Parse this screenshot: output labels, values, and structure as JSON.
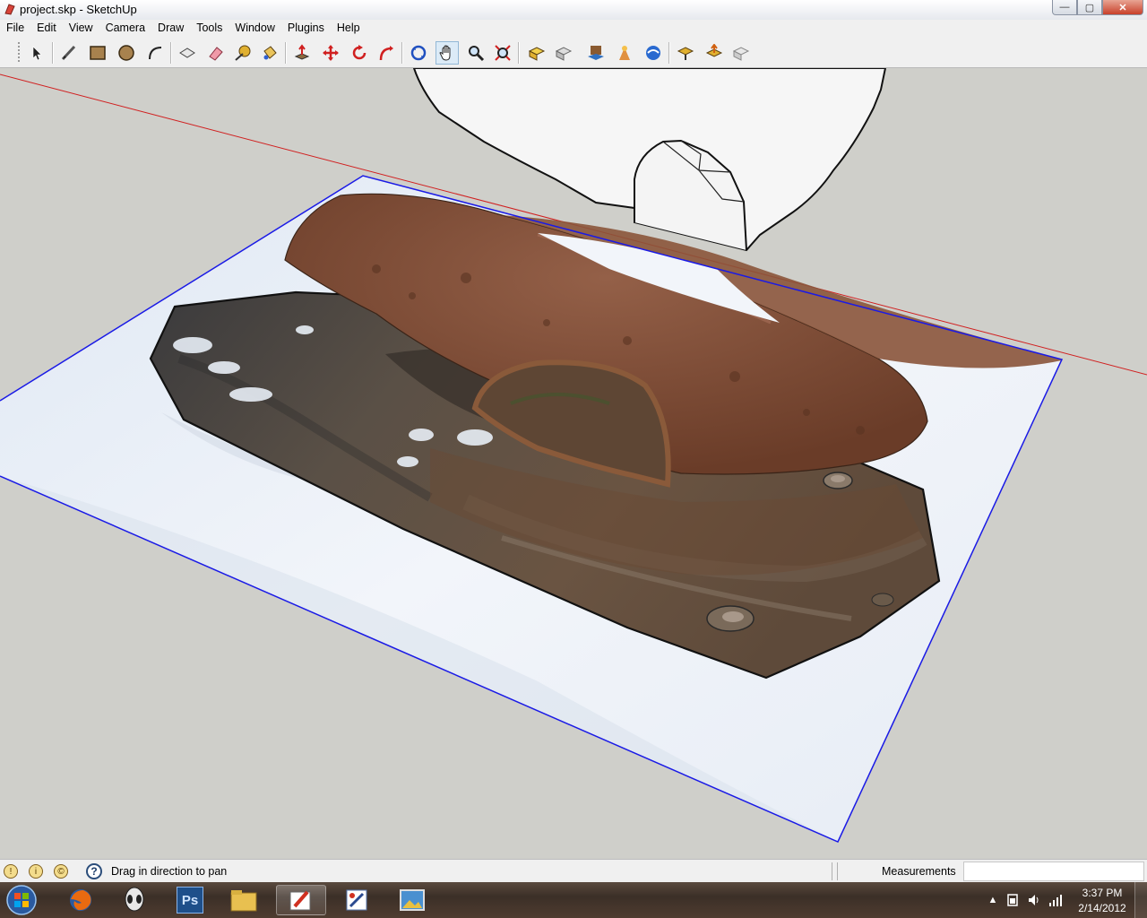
{
  "window": {
    "title": "project.skp - SketchUp",
    "controls": {
      "minimize": "—",
      "maximize": "▢",
      "close": "✕"
    }
  },
  "menu": [
    "File",
    "Edit",
    "View",
    "Camera",
    "Draw",
    "Tools",
    "Window",
    "Plugins",
    "Help"
  ],
  "toolbar": {
    "tools": [
      "select-tool-icon",
      "line-tool-icon",
      "rectangle-tool-icon",
      "circle-tool-icon",
      "arc-tool-icon",
      "make-component-icon",
      "eraser-icon",
      "tape-measure-icon",
      "paint-bucket-icon",
      "push-pull-icon",
      "move-icon",
      "rotate-icon",
      "follow-me-icon",
      "orbit-icon",
      "pan-icon",
      "zoom-icon",
      "zoom-extents-icon",
      "get-models-icon",
      "share-model-icon",
      "get-photo-texture-icon",
      "preview-google-earth-icon",
      "toggle-terrain-icon",
      "warehouse-components-icon",
      "share-component-icon",
      "extension-warehouse-icon"
    ],
    "active_tool": "pan-icon"
  },
  "statusbar": {
    "hint": "Drag in direction to pan",
    "measurements_label": "Measurements",
    "measurements_value": ""
  },
  "taskbar": {
    "apps": [
      {
        "name": "firefox-icon",
        "open": false
      },
      {
        "name": "alienware-icon",
        "open": false
      },
      {
        "name": "photoshop-icon",
        "label": "Ps",
        "open": false
      },
      {
        "name": "file-explorer-icon",
        "open": false
      },
      {
        "name": "sketchup-icon",
        "open": true
      },
      {
        "name": "paint-icon",
        "open": false
      },
      {
        "name": "photo-viewer-icon",
        "open": false
      }
    ],
    "clock_time": "3:37 PM",
    "clock_date": "2/14/2012"
  },
  "colors": {
    "red_axis": "#d02020",
    "blue_axis": "#1a1ae6",
    "viewport_bg": "#cfcfca",
    "rust": "#7a4a30"
  }
}
